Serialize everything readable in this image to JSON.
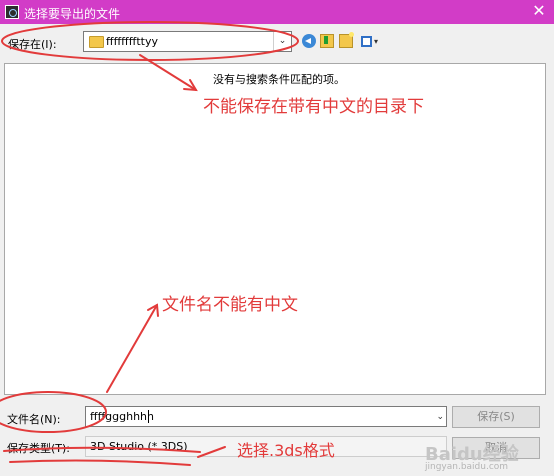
{
  "window": {
    "title": "选择要导出的文件",
    "close_glyph": "✕",
    "title_bar_color": "#d23cc7"
  },
  "save_in": {
    "label": "保存在(I):",
    "folder": "ffffffffttyy",
    "dropdown_glyph": "⌄"
  },
  "toolbar": {
    "icons": [
      "back-icon",
      "up-folder-icon",
      "new-folder-icon",
      "view-menu-icon"
    ],
    "view_arrow_glyph": "▾"
  },
  "file_list": {
    "empty_message": "没有与搜索条件匹配的项。"
  },
  "filename": {
    "label": "文件名(N):",
    "value": "ffffggghhhh",
    "dropdown_glyph": "⌄"
  },
  "filetype": {
    "label": "保存类型(T):",
    "value": "3D Studio (*.3DS)"
  },
  "buttons": {
    "save": "保存(S)",
    "cancel": "取消"
  },
  "annotations": {
    "color": "#e23b3b",
    "note_directory": "不能保存在带有中文的目录下",
    "note_filename": "文件名不能有中文",
    "note_format": "选择.3ds格式"
  },
  "watermark": {
    "logo": "Baidu经验",
    "url": "jingyan.baidu.com"
  }
}
